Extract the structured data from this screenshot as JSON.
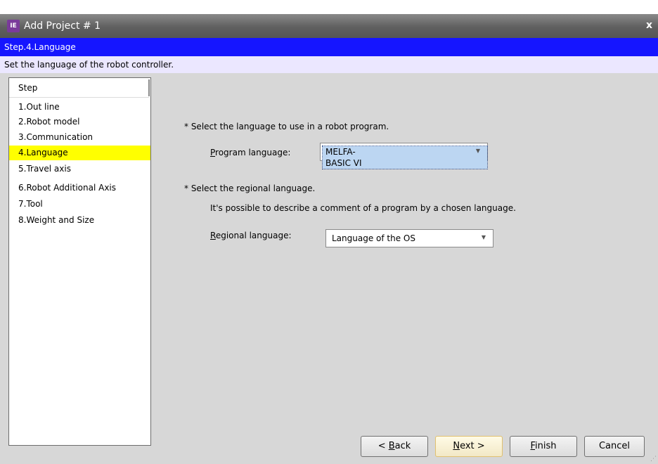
{
  "window": {
    "title": "Add Project # 1",
    "icon": "project-app-icon",
    "close_glyph": "x"
  },
  "step_header": "Step.4.Language",
  "step_description": "Set the language of the robot controller.",
  "sidebar": {
    "header": "Step",
    "items": [
      {
        "label": "1.Out line"
      },
      {
        "label": "2.Robot model"
      },
      {
        "label": "3.Communication"
      },
      {
        "label": "4.Language",
        "selected": true
      },
      {
        "label": "5.Travel axis"
      },
      {
        "label": "6.Robot Additional Axis"
      },
      {
        "label": "7.Tool"
      },
      {
        "label": "8.Weight and Size"
      }
    ]
  },
  "main": {
    "program_prompt": "* Select the language to use in a robot program.",
    "program_label_first": "P",
    "program_label_rest": "rogram language:",
    "program_value": "MELFA-BASIC VI",
    "regional_prompt": "* Select the regional language.",
    "regional_note": "It's possible to describe a comment of a program by a chosen language.",
    "regional_label_first": "R",
    "regional_label_rest": "egional language:",
    "regional_value": "Language of the OS"
  },
  "buttons": {
    "back_prefix": "< ",
    "back_mn": "B",
    "back_rest": "ack",
    "next_mn": "N",
    "next_rest": "ext >",
    "finish_mn": "F",
    "finish_rest": "inish",
    "cancel": "Cancel"
  },
  "colors": {
    "step_bar": "#1515ff",
    "description_bar": "#ebe7ff",
    "selected_step": "#ffff00"
  }
}
